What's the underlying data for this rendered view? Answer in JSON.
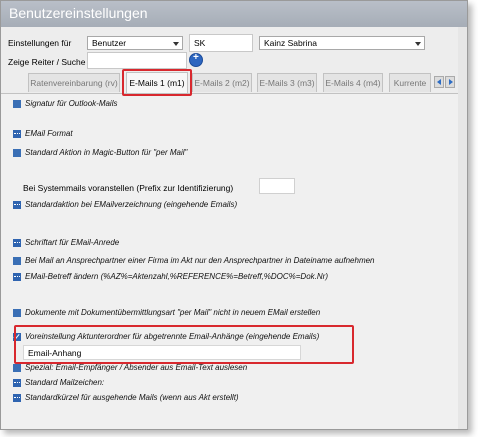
{
  "window": {
    "title": "Benutzereinstellungen"
  },
  "settings_for": {
    "label": "Einstellungen für",
    "type_value": "Benutzer",
    "code_value": "SK",
    "user_value": "Kainz Sabrina"
  },
  "search": {
    "label": "Zeige Reiter / Suche",
    "value": ""
  },
  "tabs": [
    {
      "label": "Ratenvereinbarung (rv)"
    },
    {
      "label": "E-Mails 1 (m1)"
    },
    {
      "label": "E-Mails 2 (m2)"
    },
    {
      "label": "E-Mails 3 (m3)"
    },
    {
      "label": "E-Mails 4 (m4)"
    },
    {
      "label": "Kurrente"
    }
  ],
  "options": {
    "signatur": "Signatur für Outlook-Mails",
    "email_format": "EMail Format",
    "standard_aktion": "Standard Aktion in Magic-Button für \"per Mail\"",
    "systemmails_label": "Bei Systemmails voranstellen (Prefix zur Identifizierung)",
    "standardaktion_ev": "Standardaktion bei EMailverzeichnung (eingehende Emails)",
    "schriftart": "Schriftart für EMail-Anrede",
    "ansprechpartner": "Bei Mail an Ansprechpartner einer Firma im Akt nur den Ansprechpartner in Dateiname aufnehmen",
    "betreff": "EMail-Betreff ändern (%AZ%=Aktenzahl,%REFERENCE%=Betreff,%DOC%=Dok.Nr)",
    "dokumente": "Dokumente mit Dokumentübermittlungsart \"per Mail\" nicht in neuem EMail erstellen",
    "voreinstellung": "Voreinstellung Aktunterordner für abgetrennte Email-Anhänge (eingehende Emails)",
    "voreinstellung_value": "Email-Anhang",
    "spezial": "Spezial: Email-Empfänger / Absender aus Email-Text auslesen",
    "mailzeichen": "Standard Mailzeichen:",
    "kuerzel": "Standardkürzel für ausgehende Mails (wenn aus Akt erstellt)"
  },
  "colors": {
    "highlight": "#d8282e",
    "icon": "#2f64b0"
  }
}
